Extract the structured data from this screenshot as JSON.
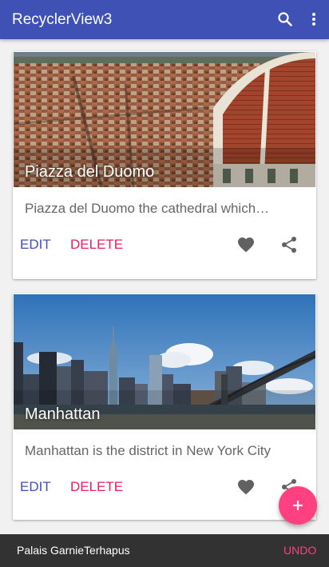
{
  "app_bar": {
    "title": "RecyclerView3",
    "background": "#3f51b5",
    "actions": [
      "search-icon",
      "more-vert-icon"
    ]
  },
  "cards": [
    {
      "title": "Piazza del Duomo",
      "description": "Piazza del Duomo the cathedral which…",
      "edit_label": "EDIT",
      "delete_label": "DELETE",
      "actions": [
        "favorite-icon",
        "share-icon"
      ]
    },
    {
      "title": "Manhattan",
      "description": "Manhattan is the district in New York City",
      "edit_label": "EDIT",
      "delete_label": "DELETE",
      "actions": [
        "favorite-icon",
        "share-icon"
      ]
    }
  ],
  "fab": {
    "icon": "add-icon",
    "color": "#ff4081"
  },
  "snackbar": {
    "message": "Palais GarnieTerhapus",
    "action_label": "UNDO",
    "action_color": "#ff4081"
  },
  "colors": {
    "primary": "#3f51b5",
    "accent": "#ff4081",
    "edit": "#3f51b5",
    "delete": "#e91e63"
  }
}
